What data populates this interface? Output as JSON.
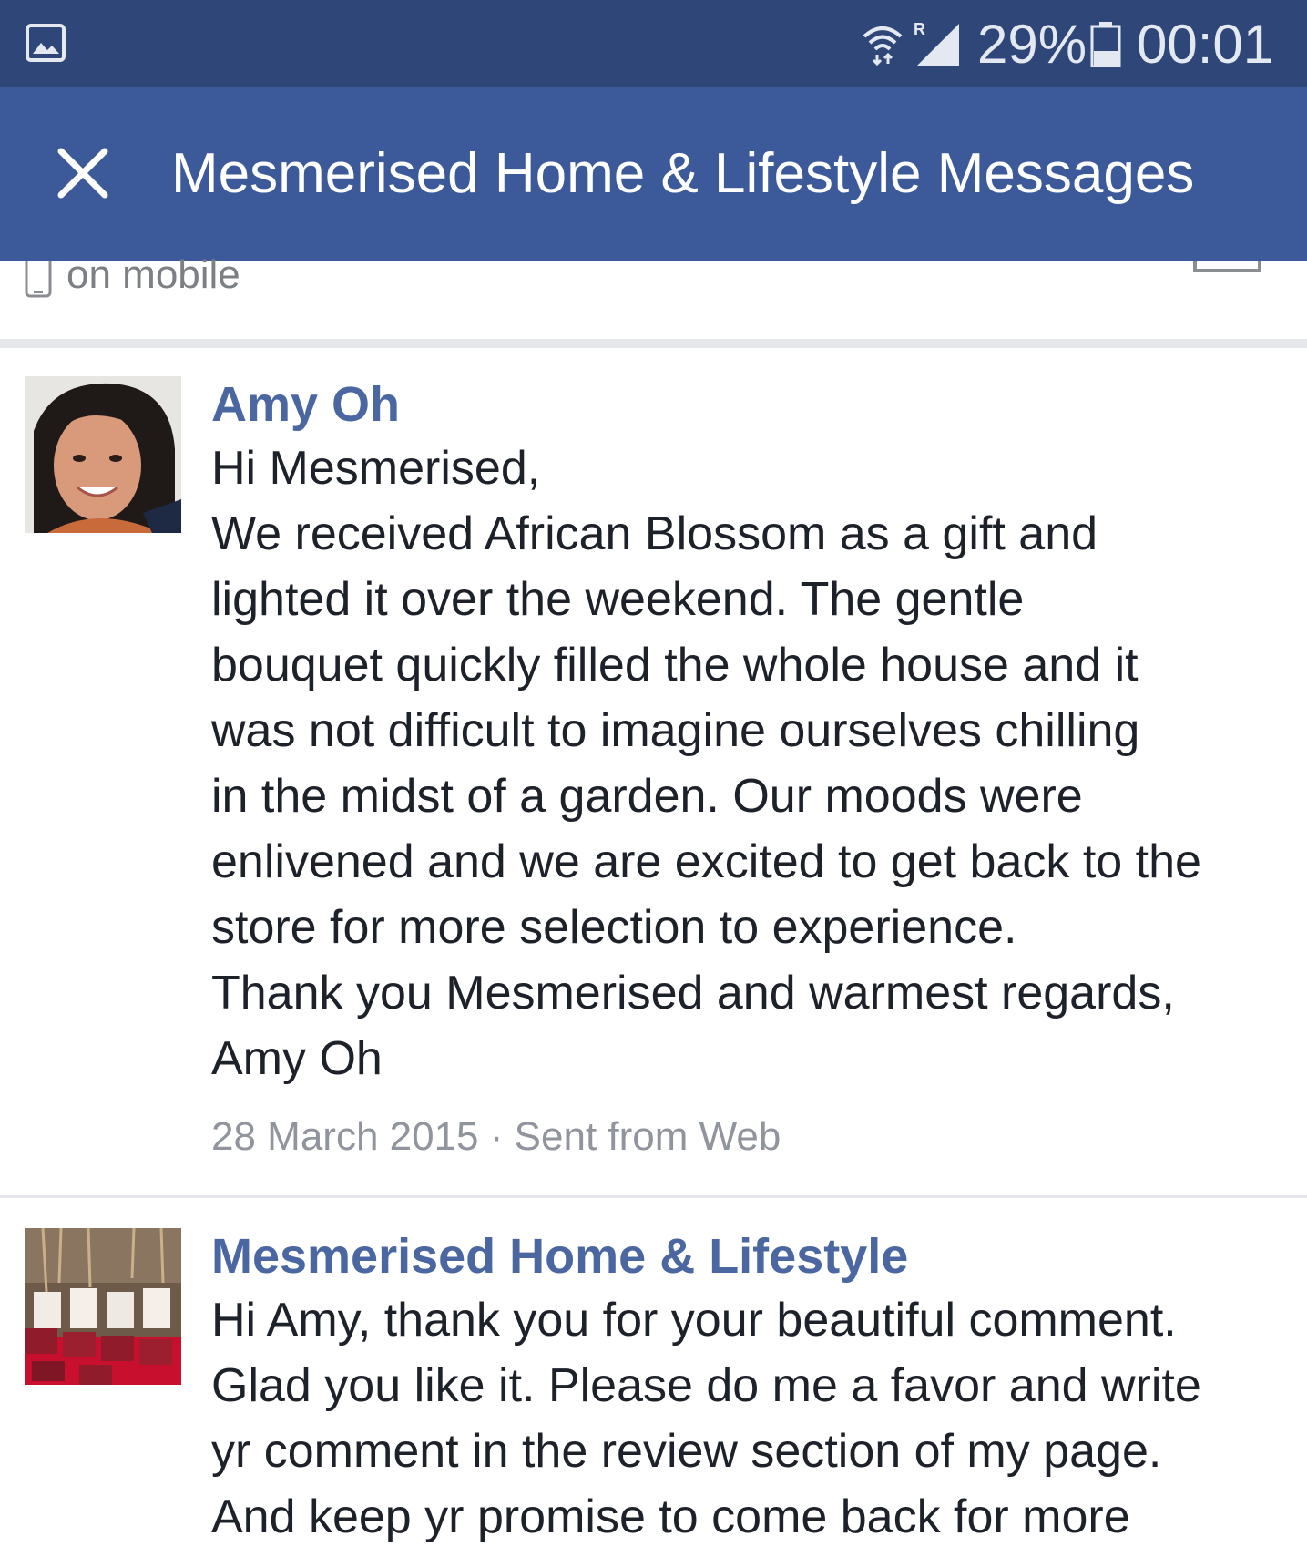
{
  "status_bar": {
    "battery_percent": "29%",
    "time": "00:01",
    "icons": [
      "gallery-icon",
      "wifi-icon",
      "signal-roaming-icon",
      "battery-icon"
    ]
  },
  "header": {
    "title": "Mesmerised Home & Lifestyle Messages",
    "close_icon": "close-icon"
  },
  "previous_row": {
    "status_text": "on mobile",
    "icon": "mobile-phone-icon"
  },
  "messages": [
    {
      "sender": "Amy Oh",
      "lines": [
        "Hi Mesmerised,",
        "We received African Blossom as a gift and",
        "lighted it over the weekend. The gentle",
        "bouquet quickly filled the whole house and it",
        "was not difficult to imagine ourselves chilling",
        "in the midst of a garden. Our moods were",
        "enlivened and we are excited to get back to the",
        "store for more selection to experience.",
        "Thank you Mesmerised and warmest regards,",
        "Amy Oh"
      ],
      "date": "28 March 2015",
      "separator": "·",
      "source": "Sent from Web"
    },
    {
      "sender": "Mesmerised Home & Lifestyle",
      "lines": [
        "Hi Amy, thank you for your beautiful comment.",
        "Glad you like it. Please do me a favor and write",
        "yr comment in the review section of my page.",
        "And keep yr promise to come back for more"
      ]
    }
  ],
  "colors": {
    "status_bar": "#2e4778",
    "title_bar": "#3c5a9a",
    "sender_name": "#4b67a1",
    "body_text": "#1d2129",
    "meta_text": "#90949c",
    "divider": "#e6e7eb"
  }
}
